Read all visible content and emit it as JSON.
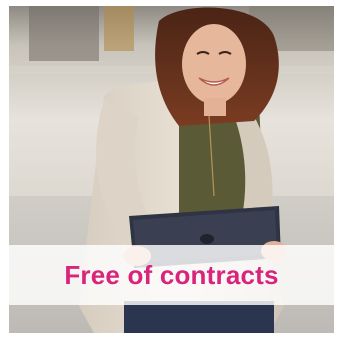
{
  "card": {
    "caption": "Free of contracts",
    "accent_color": "#d8247a",
    "image_subject": "woman-using-tablet-photo"
  }
}
